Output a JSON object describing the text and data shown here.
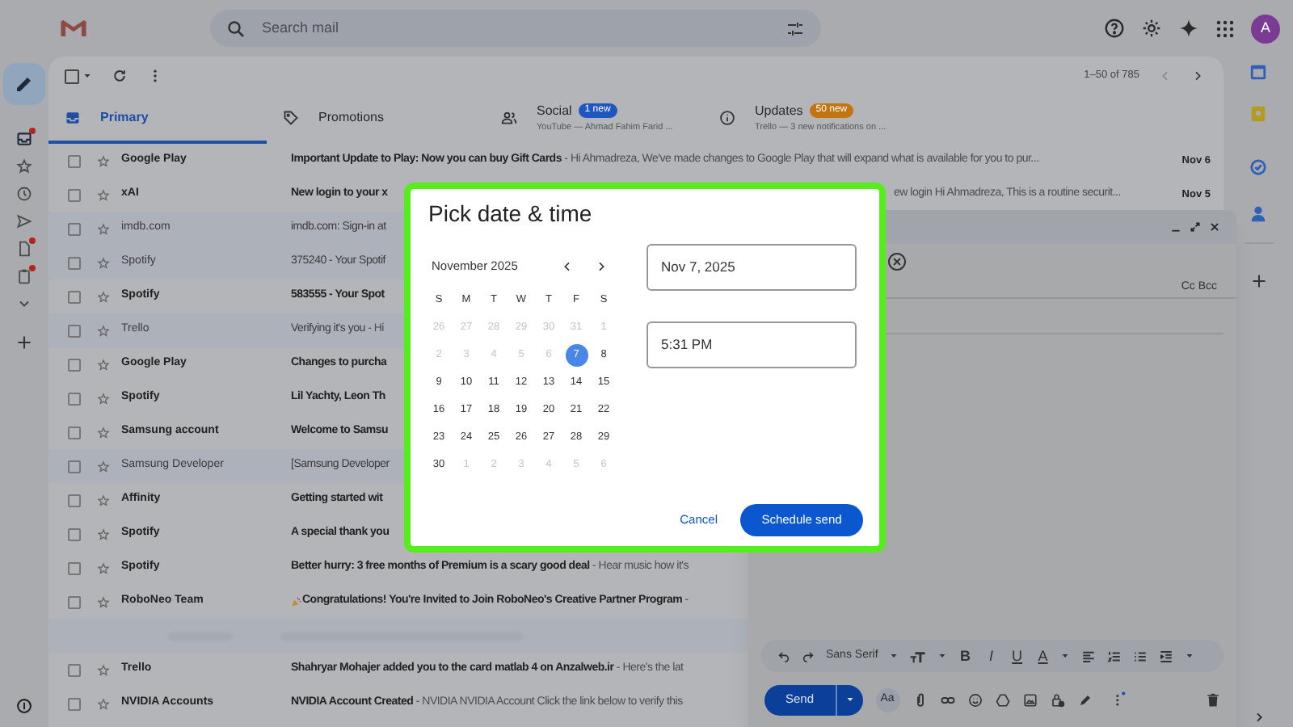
{
  "header": {
    "search_placeholder": "Search mail",
    "avatar": "A"
  },
  "sidebar": {
    "items": [
      {
        "kind": "inbox",
        "dot": true,
        "selected": true
      },
      {
        "kind": "star",
        "dot": false,
        "selected": false
      },
      {
        "kind": "clock",
        "dot": false,
        "selected": false
      },
      {
        "kind": "send",
        "dot": false,
        "selected": false
      },
      {
        "kind": "file",
        "dot": true,
        "selected": false
      },
      {
        "kind": "clipboard",
        "dot": true,
        "selected": false
      },
      {
        "kind": "chevron",
        "dot": false,
        "selected": false
      }
    ]
  },
  "toolbar": {
    "select_all_checked": false,
    "range": "1–50 of 785"
  },
  "tabs": [
    {
      "kind": "primary",
      "label": "Primary",
      "selected": true
    },
    {
      "kind": "promotions",
      "label": "Promotions",
      "selected": false
    },
    {
      "kind": "social",
      "label": "Social",
      "selected": false,
      "badge": "1 new",
      "color": "#1f56c0",
      "subtitle": "YouTube — Ahmad Fahim Farid ..."
    },
    {
      "kind": "updates",
      "label": "Updates",
      "selected": false,
      "badge": "50 new",
      "color": "#c27411",
      "subtitle": "Trello — 3 new notifications on ..."
    }
  ],
  "emails": [
    {
      "kind": "mail",
      "sender": "Google Play",
      "subject": "Important Update to Play: Now you can buy Gift Cards",
      "snippet": " - Hi Ahmadreza, We've made changes to Google Play that will expand what is available for you to pur...",
      "date": "Nov 6",
      "unread": true
    },
    {
      "kind": "mail",
      "sender": "xAI",
      "subject": "New login to your x",
      "tail": "ew login Hi Ahmadreza, This is a routine securit...",
      "date": "Nov 5",
      "unread": true
    },
    {
      "kind": "mail",
      "sender": "imdb.com",
      "subject": "imdb.com: Sign-in at",
      "unread": false
    },
    {
      "kind": "mail",
      "sender": "Spotify",
      "subject": "375240 - Your Spotif",
      "unread": false
    },
    {
      "kind": "mail",
      "sender": "Spotify",
      "subject": "583555 - Your Spot",
      "unread": true
    },
    {
      "kind": "mail",
      "sender": "Trello",
      "subject": "Verifying it's you",
      "snippet": " - Hi",
      "unread": false
    },
    {
      "kind": "mail",
      "sender": "Google Play",
      "subject": "Changes to purcha",
      "unread": true
    },
    {
      "kind": "mail",
      "sender": "Spotify",
      "subject": "Lil Yachty, Leon Th",
      "unread": true
    },
    {
      "kind": "mail",
      "sender": "Samsung account",
      "subject": "Welcome to Samsu",
      "unread": true
    },
    {
      "kind": "mail",
      "sender": "Samsung Developer",
      "subject": "[Samsung Developer",
      "unread": false
    },
    {
      "kind": "mail",
      "sender": "Affinity",
      "subject": "Getting started wit",
      "unread": true
    },
    {
      "kind": "mail",
      "sender": "Spotify",
      "subject": "A special thank you",
      "unread": true
    },
    {
      "kind": "mail",
      "sender": "Spotify",
      "subject": "Better hurry: 3 free months of Premium is a scary good deal",
      "snippet": " - Hear music how it's",
      "unread": true
    },
    {
      "kind": "celebration",
      "sender": "RoboNeo Team",
      "subject": "Congratulations! You're Invited to Join RoboNeo's Creative Partner Program",
      "snippet": " -",
      "unread": true
    },
    {
      "kind": "obscured"
    },
    {
      "kind": "mail",
      "sender": "Trello",
      "subject": "Shahryar Mohajer added you to the card matlab 4 on Anzalweb.ir",
      "snippet": " - Here's the lat",
      "unread": true
    },
    {
      "kind": "mail",
      "sender": "NVIDIA Accounts",
      "subject": "NVIDIA Account Created",
      "snippet": " - NVIDIA NVIDIA Account Click the link below to verify this",
      "unread": true
    }
  ],
  "compose": {
    "cc_bcc": "Cc Bcc",
    "font": "Sans Serif",
    "format_letters": [
      "B",
      "I",
      "U",
      "A"
    ],
    "format_options": "Aa",
    "send": "Send"
  },
  "dialog": {
    "title": "Pick date & time",
    "month": "November 2025",
    "weekdays": [
      "S",
      "M",
      "T",
      "W",
      "T",
      "F",
      "S"
    ],
    "days": [
      {
        "day": "26",
        "disabled": true,
        "selected": false
      },
      {
        "day": "27",
        "disabled": true,
        "selected": false
      },
      {
        "day": "28",
        "disabled": true,
        "selected": false
      },
      {
        "day": "29",
        "disabled": true,
        "selected": false
      },
      {
        "day": "30",
        "disabled": true,
        "selected": false
      },
      {
        "day": "31",
        "disabled": true,
        "selected": false
      },
      {
        "day": "1",
        "disabled": true,
        "selected": false
      },
      {
        "day": "2",
        "disabled": true,
        "selected": false
      },
      {
        "day": "3",
        "disabled": true,
        "selected": false
      },
      {
        "day": "4",
        "disabled": true,
        "selected": false
      },
      {
        "day": "5",
        "disabled": true,
        "selected": false
      },
      {
        "day": "6",
        "disabled": true,
        "selected": false
      },
      {
        "day": "7",
        "disabled": false,
        "selected": true
      },
      {
        "day": "8",
        "disabled": false,
        "selected": false
      },
      {
        "day": "9",
        "disabled": false,
        "selected": false
      },
      {
        "day": "10",
        "disabled": false,
        "selected": false
      },
      {
        "day": "11",
        "disabled": false,
        "selected": false
      },
      {
        "day": "12",
        "disabled": false,
        "selected": false
      },
      {
        "day": "13",
        "disabled": false,
        "selected": false
      },
      {
        "day": "14",
        "disabled": false,
        "selected": false
      },
      {
        "day": "15",
        "disabled": false,
        "selected": false
      },
      {
        "day": "16",
        "disabled": false,
        "selected": false
      },
      {
        "day": "17",
        "disabled": false,
        "selected": false
      },
      {
        "day": "18",
        "disabled": false,
        "selected": false
      },
      {
        "day": "19",
        "disabled": false,
        "selected": false
      },
      {
        "day": "20",
        "disabled": false,
        "selected": false
      },
      {
        "day": "21",
        "disabled": false,
        "selected": false
      },
      {
        "day": "22",
        "disabled": false,
        "selected": false
      },
      {
        "day": "23",
        "disabled": false,
        "selected": false
      },
      {
        "day": "24",
        "disabled": false,
        "selected": false
      },
      {
        "day": "25",
        "disabled": false,
        "selected": false
      },
      {
        "day": "26",
        "disabled": false,
        "selected": false
      },
      {
        "day": "27",
        "disabled": false,
        "selected": false
      },
      {
        "day": "28",
        "disabled": false,
        "selected": false
      },
      {
        "day": "29",
        "disabled": false,
        "selected": false
      },
      {
        "day": "30",
        "disabled": false,
        "selected": false
      },
      {
        "day": "1",
        "disabled": true,
        "selected": false
      },
      {
        "day": "2",
        "disabled": true,
        "selected": false
      },
      {
        "day": "3",
        "disabled": true,
        "selected": false
      },
      {
        "day": "4",
        "disabled": true,
        "selected": false
      },
      {
        "day": "5",
        "disabled": true,
        "selected": false
      },
      {
        "day": "6",
        "disabled": true,
        "selected": false
      }
    ],
    "date": "Nov 7, 2025",
    "time": "5:31 PM",
    "cancel": "Cancel",
    "confirm": "Schedule send"
  }
}
